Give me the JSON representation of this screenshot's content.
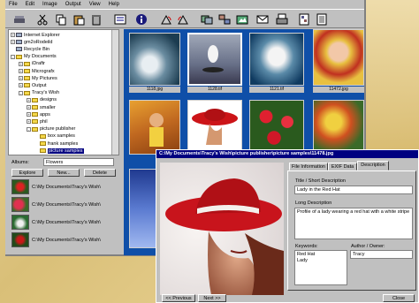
{
  "menu": [
    "File",
    "Edit",
    "Image",
    "Output",
    "View",
    "Help"
  ],
  "tree": {
    "items": [
      {
        "label": "Internet Explorer",
        "depth": 0,
        "toggle": "+",
        "kind": "pc"
      },
      {
        "label": "gm2oRodeild",
        "depth": 0,
        "toggle": "+",
        "kind": "pc"
      },
      {
        "label": "Recycle Bin",
        "depth": 0,
        "toggle": "",
        "kind": "pc"
      },
      {
        "label": "My Documents",
        "depth": 0,
        "toggle": "-",
        "kind": "folder"
      },
      {
        "label": "iDraftr",
        "depth": 1,
        "toggle": "+",
        "kind": "folder"
      },
      {
        "label": "Micrografx",
        "depth": 1,
        "toggle": "+",
        "kind": "folder"
      },
      {
        "label": "My Pictures",
        "depth": 1,
        "toggle": "+",
        "kind": "folder"
      },
      {
        "label": "Output",
        "depth": 1,
        "toggle": "+",
        "kind": "folder"
      },
      {
        "label": "Tracy's Wish",
        "depth": 1,
        "toggle": "-",
        "kind": "folder"
      },
      {
        "label": "designs",
        "depth": 2,
        "toggle": "+",
        "kind": "folder"
      },
      {
        "label": "smaller",
        "depth": 2,
        "toggle": "+",
        "kind": "folder"
      },
      {
        "label": "apps",
        "depth": 2,
        "toggle": "+",
        "kind": "folder"
      },
      {
        "label": "phil",
        "depth": 2,
        "toggle": "+",
        "kind": "folder"
      },
      {
        "label": "picture publisher",
        "depth": 2,
        "toggle": "-",
        "kind": "folder"
      },
      {
        "label": "box samples",
        "depth": 3,
        "toggle": "",
        "kind": "folder"
      },
      {
        "label": "frank samples",
        "depth": 3,
        "toggle": "",
        "kind": "folder"
      },
      {
        "label": "picture samples",
        "depth": 3,
        "toggle": "",
        "kind": "folder",
        "selected": true
      }
    ]
  },
  "album": {
    "label": "Albums:",
    "selected": "Flowers",
    "buttons": [
      "Explore",
      "New...",
      "Delete"
    ],
    "rows": [
      {
        "path": "C:\\My Documents\\Tracy's Wish\\"
      },
      {
        "path": "C:\\My Documents\\Tracy's Wish\\"
      },
      {
        "path": "C:\\My Documents\\Tracy's Wish\\"
      },
      {
        "path": "C:\\My Documents\\Tracy's Wish\\"
      }
    ]
  },
  "thumbs": {
    "row1": [
      "1118.jpg",
      "1128.tif",
      "1121.tif",
      "11472.jpg"
    ],
    "row2": [
      "",
      "",
      "",
      ""
    ]
  },
  "dialog": {
    "title": "C:\\My Documents\\Tracy's Wish\\picture publisher\\picture samples\\11478.jpg",
    "tabs": [
      "File Information",
      "EXIF Data",
      "Description"
    ],
    "title_label": "Title / Short Description",
    "title_value": "Lady in the Red Hat",
    "long_label": "Long Description",
    "long_value": "Profile of a lady wearing a red hat with a white stripe",
    "keywords_label": "Keywords:",
    "keywords": [
      "Red Hat",
      "Lady"
    ],
    "author_label": "Author / Owner:",
    "author_value": "Tracy",
    "prev": "<< Previous",
    "next": "Next >>",
    "close": "Close"
  },
  "colors": {
    "title_bar": "#000080",
    "thumb_bg": "#0f4fa8",
    "hat_red": "#c8141c"
  }
}
